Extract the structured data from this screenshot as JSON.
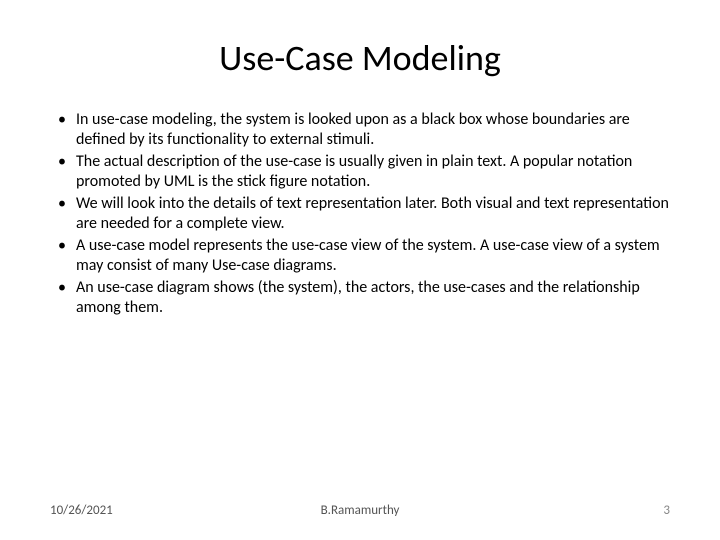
{
  "title": "Use-Case Modeling",
  "bullets": [
    "In use-case modeling, the system is looked upon as a black box whose boundaries are defined by its functionality to external stimuli.",
    "The actual description of the use-case is usually given in plain text. A popular notation promoted by UML is the stick figure notation.",
    "We will look into the details of text representation later. Both visual and text representation are needed for a complete view.",
    "A use-case model represents the use-case view of the system. A use-case view of a system may consist of many Use-case diagrams.",
    "An use-case diagram shows (the system), the actors, the use-cases and the relationship among them."
  ],
  "footer": {
    "date": "10/26/2021",
    "author": "B.Ramamurthy",
    "page": "3"
  }
}
